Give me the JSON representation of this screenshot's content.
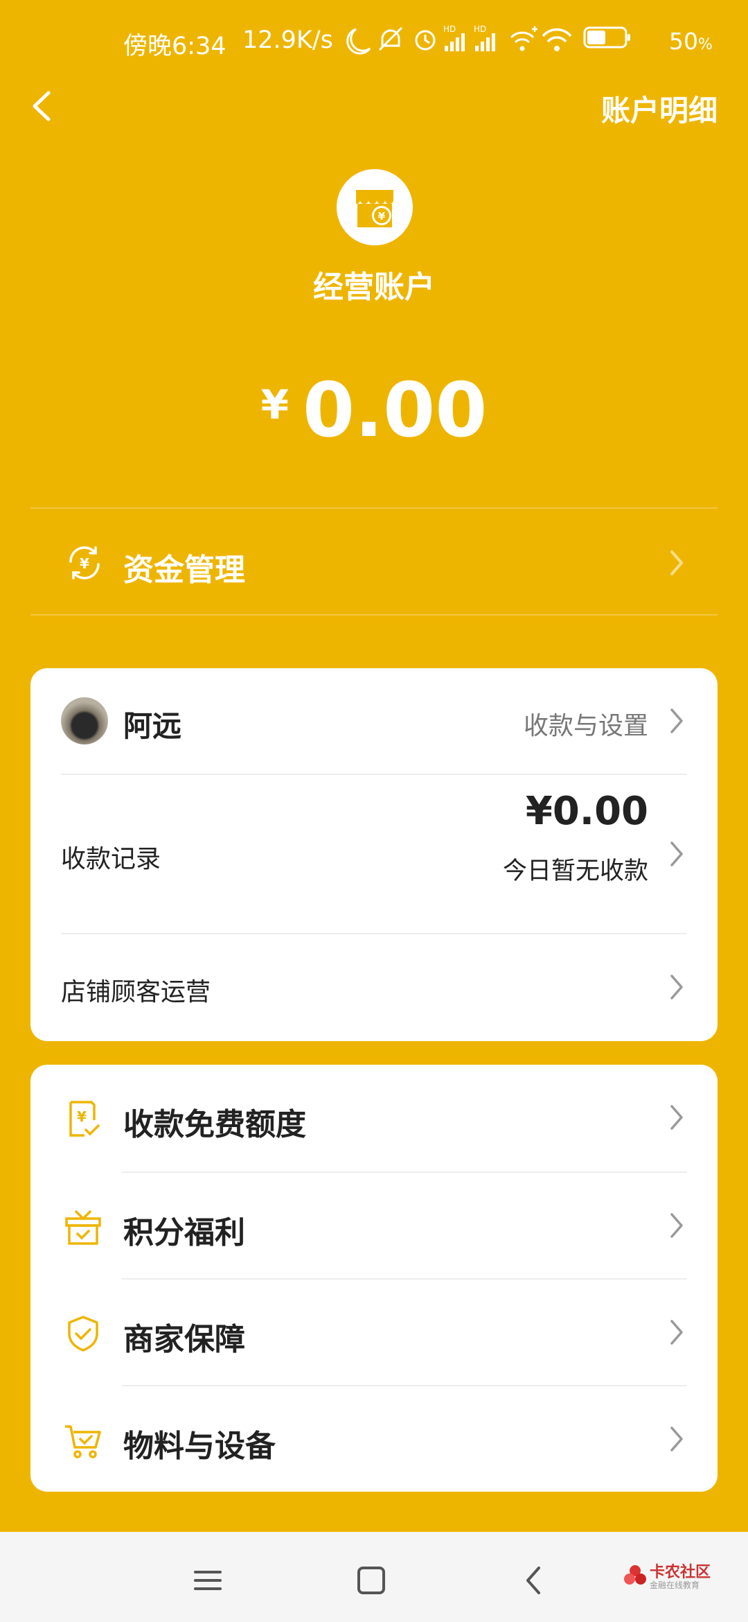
{
  "status_bar": {
    "time": "傍晚6:34",
    "network_speed": "12.9K/s",
    "battery_percent": "50",
    "battery_suffix": "%",
    "icons": [
      "moon-icon",
      "mute-icon",
      "alarm-icon",
      "hd-signal-icon",
      "hd-signal-icon",
      "wifi-plus-icon",
      "wifi-icon",
      "battery-icon"
    ]
  },
  "header": {
    "back_icon": "chevron-left-icon",
    "detail_link": "账户明细"
  },
  "account": {
    "icon": "shop-yen-icon",
    "title": "经营账户",
    "currency": "¥",
    "balance": "0.00"
  },
  "fund_management": {
    "icon": "yen-cycle-icon",
    "label": "资金管理"
  },
  "merchant_card": {
    "name": "阿远",
    "settings_link": "收款与设置",
    "records_label": "收款记录",
    "records_amount": "¥0.00",
    "records_note": "今日暂无收款",
    "customer_label": "店铺顾客运营"
  },
  "menu": {
    "items": [
      {
        "icon": "receipt-yen-icon",
        "label": "收款免费额度"
      },
      {
        "icon": "gift-icon",
        "label": "积分福利"
      },
      {
        "icon": "shield-check-icon",
        "label": "商家保障"
      },
      {
        "icon": "cart-icon",
        "label": "物料与设备"
      }
    ]
  },
  "nav_bar": {
    "buttons": [
      "menu-icon",
      "home-square-icon",
      "back-icon"
    ],
    "watermark_main": "卡农社区",
    "watermark_sub": "金融在线教育"
  },
  "colors": {
    "background": "#EEB500",
    "card": "#FFFFFF",
    "accent_icon": "#EEB500"
  }
}
